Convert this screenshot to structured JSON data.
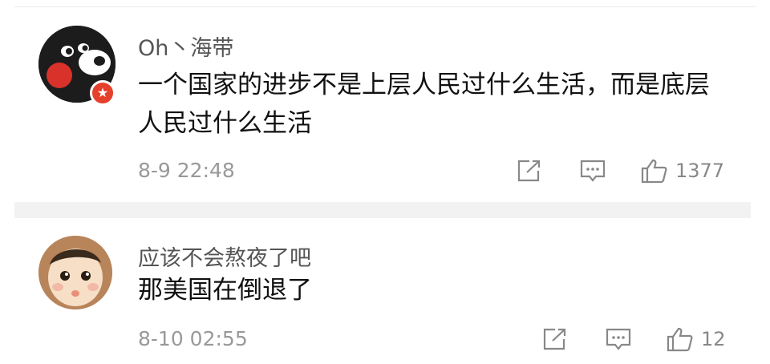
{
  "comments": [
    {
      "username": "Oh丶海带",
      "text": "一个国家的进步不是上层人民过什么生活，而是底层人民过什么生活",
      "time": "8-9 22:48",
      "likes": "1377",
      "avatar_icon": "black-bear-avatar",
      "badge_icon": "red-star-badge-icon",
      "badge_color": "#e5402b"
    },
    {
      "username": "应该不会熬夜了吧",
      "text": "那美国在倒退了",
      "time": "8-10 02:55",
      "likes": "12",
      "avatar_icon": "baby-face-avatar"
    }
  ],
  "colors": {
    "username": "#555555",
    "text": "#111111",
    "meta": "#999999",
    "divider": "#f2f2f2"
  }
}
